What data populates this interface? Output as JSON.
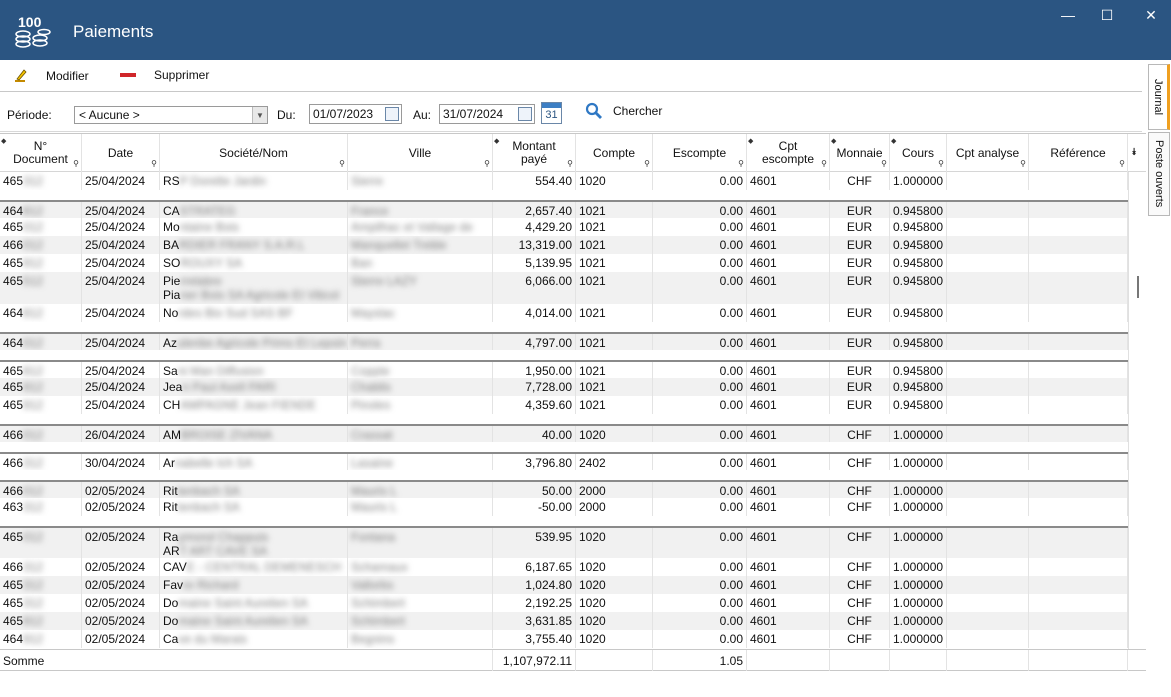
{
  "window": {
    "logo_text": "100",
    "title": "Paiements",
    "minimize": "—",
    "maximize": "☐",
    "close": "✕"
  },
  "toolbar": {
    "edit_label": "Modifier",
    "delete_label": "Supprimer"
  },
  "filters": {
    "period_label": "Période:",
    "period_value": "< Aucune >",
    "from_label": "Du:",
    "from_value": "01/07/2023",
    "to_label": "Au:",
    "to_value": "31/07/2024",
    "calendar_day": "31",
    "search_label": "Chercher"
  },
  "side_tabs": {
    "journal": "Journal",
    "postes": "Poste ouverts"
  },
  "columns": [
    "N° Document",
    "Date",
    "Société/Nom",
    "Ville",
    "Montant payé",
    "Compte",
    "Escompte",
    "Cpt escompte",
    "Monnaie",
    "Cours",
    "Cpt analyse",
    "Référence"
  ],
  "rows": [
    {
      "doc": "4653",
      "date": "25/04/2024",
      "soc": "RS",
      "soc_hidden": "P Dorette Jardin",
      "ville": "Sierre",
      "montant": "554.40",
      "compte": "1020",
      "escompte": "0.00",
      "cpt": "4601",
      "monnaie": "CHF",
      "cours": "1.000000"
    },
    {
      "doc": "4648",
      "date": "25/04/2024",
      "soc": "CA",
      "soc_hidden": "STRATEG",
      "ville": "France",
      "montant": "2,657.40",
      "compte": "1021",
      "escompte": "0.00",
      "cpt": "4601",
      "monnaie": "EUR",
      "cours": "0.945800"
    },
    {
      "doc": "4650",
      "date": "25/04/2024",
      "soc": "Mo",
      "soc_hidden": "ntaine Bois",
      "ville": "Ampilhac et Vallage de",
      "montant": "4,429.20",
      "compte": "1021",
      "escompte": "0.00",
      "cpt": "4601",
      "monnaie": "EUR",
      "cours": "0.945800"
    },
    {
      "doc": "4660",
      "date": "25/04/2024",
      "soc": "BA",
      "soc_hidden": "RDIER FRANY S.A.R.L",
      "ville": "Manquellet Treble",
      "montant": "13,319.00",
      "compte": "1021",
      "escompte": "0.00",
      "cpt": "4601",
      "monnaie": "EUR",
      "cours": "0.945800"
    },
    {
      "doc": "4659",
      "date": "25/04/2024",
      "soc": "SO",
      "soc_hidden": "ROUXY SA",
      "ville": "Ban",
      "montant": "5,139.95",
      "compte": "1021",
      "escompte": "0.00",
      "cpt": "4601",
      "monnaie": "EUR",
      "cours": "0.945800"
    },
    {
      "doc": "4655",
      "date": "25/04/2024",
      "soc": "Pie",
      "soc_hidden": "rrelabre",
      "soc_line2": "Pia",
      "soc_line2_hidden": "ner Bois SA Agricole Et Viticol",
      "ville": "Sterre LAZY",
      "montant": "6,066.00",
      "compte": "1021",
      "escompte": "0.00",
      "cpt": "4601",
      "monnaie": "EUR",
      "cours": "0.945800"
    },
    {
      "doc": "4648",
      "date": "25/04/2024",
      "soc": "No",
      "soc_hidden": "rdes Bio Sud SAS BF",
      "ville": "Mayslac",
      "montant": "4,014.00",
      "compte": "1021",
      "escompte": "0.00",
      "cpt": "4601",
      "monnaie": "EUR",
      "cours": "0.945800"
    },
    {
      "doc": "4640",
      "date": "25/04/2024",
      "soc": "Az",
      "soc_hidden": "ulenbe Agricole Prims Et Lepoin",
      "ville": "Perra",
      "montant": "4,797.00",
      "compte": "1021",
      "escompte": "0.00",
      "cpt": "4601",
      "monnaie": "EUR",
      "cours": "0.945800"
    },
    {
      "doc": "4658",
      "date": "25/04/2024",
      "soc": "Sa",
      "soc_hidden": "ni Man Diffusion",
      "ville": "Coppte",
      "montant": "1,950.00",
      "compte": "1021",
      "escompte": "0.00",
      "cpt": "4601",
      "monnaie": "EUR",
      "cours": "0.945800"
    },
    {
      "doc": "4659",
      "date": "25/04/2024",
      "soc": "Jea",
      "soc_hidden": "n Paul Axell PARI",
      "ville": "Chablis",
      "montant": "7,728.00",
      "compte": "1021",
      "escompte": "0.00",
      "cpt": "4601",
      "monnaie": "EUR",
      "cours": "0.945800"
    },
    {
      "doc": "4659",
      "date": "25/04/2024",
      "soc": "CH",
      "soc_hidden": "AMPAGNE Jean FIENDE",
      "ville": "Pinoles",
      "montant": "4,359.60",
      "compte": "1021",
      "escompte": "0.00",
      "cpt": "4601",
      "monnaie": "EUR",
      "cours": "0.945800"
    },
    {
      "doc": "4660",
      "date": "26/04/2024",
      "soc": "AM",
      "soc_hidden": "BROISE ZIVANA",
      "ville": "Crassat",
      "montant": "40.00",
      "compte": "1020",
      "escompte": "0.00",
      "cpt": "4601",
      "monnaie": "CHF",
      "cours": "1.000000"
    },
    {
      "doc": "4663",
      "date": "30/04/2024",
      "soc": "Ar",
      "soc_hidden": "nabelle Ich SA",
      "ville": "Lasaine",
      "montant": "3,796.80",
      "compte": "2402",
      "escompte": "0.00",
      "cpt": "4601",
      "monnaie": "CHF",
      "cours": "1.000000"
    },
    {
      "doc": "4660",
      "date": "02/05/2024",
      "soc": "Rit",
      "soc_hidden": "tenbach SA",
      "ville": "Mauris L",
      "montant": "50.00",
      "compte": "2000",
      "escompte": "0.00",
      "cpt": "4601",
      "monnaie": "CHF",
      "cours": "1.000000"
    },
    {
      "doc": "4633",
      "date": "02/05/2024",
      "soc": "Rit",
      "soc_hidden": "tenbach SA",
      "ville": "Mauris L",
      "montant": "-50.00",
      "compte": "2000",
      "escompte": "0.00",
      "cpt": "4601",
      "monnaie": "CHF",
      "cours": "1.000000"
    },
    {
      "doc": "4650",
      "date": "02/05/2024",
      "soc": "Ra",
      "soc_hidden": "ymond Chappuis",
      "soc_line2": "AR",
      "soc_line2_hidden": "T ART CAVE SA",
      "ville": "Fontana",
      "montant": "539.95",
      "compte": "1020",
      "escompte": "0.00",
      "cpt": "4601",
      "monnaie": "CHF",
      "cours": "1.000000"
    },
    {
      "doc": "4663",
      "date": "02/05/2024",
      "soc": "CAV",
      "soc_hidden": "E - CENTRAL DEMENESCH",
      "ville": "Schamaux",
      "montant": "6,187.65",
      "compte": "1020",
      "escompte": "0.00",
      "cpt": "4601",
      "monnaie": "CHF",
      "cours": "1.000000"
    },
    {
      "doc": "4653",
      "date": "02/05/2024",
      "soc": "Fav",
      "soc_hidden": "re Richard",
      "ville": "Vallorbs",
      "montant": "1,024.80",
      "compte": "1020",
      "escompte": "0.00",
      "cpt": "4601",
      "monnaie": "CHF",
      "cours": "1.000000"
    },
    {
      "doc": "4653",
      "date": "02/05/2024",
      "soc": "Do",
      "soc_hidden": "maine Saint Aurelien SA",
      "ville": "Schimbert",
      "montant": "2,192.25",
      "compte": "1020",
      "escompte": "0.00",
      "cpt": "4601",
      "monnaie": "CHF",
      "cours": "1.000000"
    },
    {
      "doc": "4659",
      "date": "02/05/2024",
      "soc": "Do",
      "soc_hidden": "maine Saint Aurelien SA",
      "ville": "Schimbert",
      "montant": "3,631.85",
      "compte": "1020",
      "escompte": "0.00",
      "cpt": "4601",
      "monnaie": "CHF",
      "cours": "1.000000"
    },
    {
      "doc": "4649",
      "date": "02/05/2024",
      "soc": "Ca",
      "soc_hidden": "ve du Marais",
      "ville": "Begnins",
      "montant": "3,755.40",
      "compte": "1020",
      "escompte": "0.00",
      "cpt": "4601",
      "monnaie": "CHF",
      "cours": "1.000000"
    }
  ],
  "footer": {
    "label": "Somme",
    "total_montant": "1,107,972.11",
    "total_escompte": "1.05"
  },
  "colors": {
    "titlebar": "#2b5582",
    "delete": "#d0262a",
    "tab_accent": "#f0a020"
  }
}
